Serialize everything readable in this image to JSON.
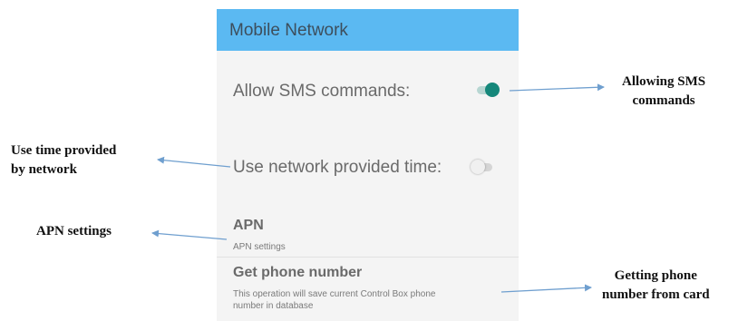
{
  "screen": {
    "title": "Mobile Network",
    "allow_sms": {
      "label": "Allow SMS commands:",
      "enabled": true
    },
    "network_time": {
      "label": "Use network provided time:",
      "enabled": false
    },
    "apn": {
      "title": "APN",
      "summary": "APN settings"
    },
    "phone_number": {
      "title": "Get phone number",
      "summary_line1": "This operation will save current Control Box phone",
      "summary_line2": "number in database"
    }
  },
  "annotations": {
    "allowing_sms": [
      "Allowing SMS",
      "commands"
    ],
    "use_time": [
      "Use time provided",
      "by network"
    ],
    "apn_settings": "APN settings",
    "getting_phone": [
      "Getting phone",
      "number from card"
    ]
  },
  "colors": {
    "title_bar": "#5bb9f2",
    "switch_on": "#15877a",
    "arrow": "#6f9fcf"
  }
}
